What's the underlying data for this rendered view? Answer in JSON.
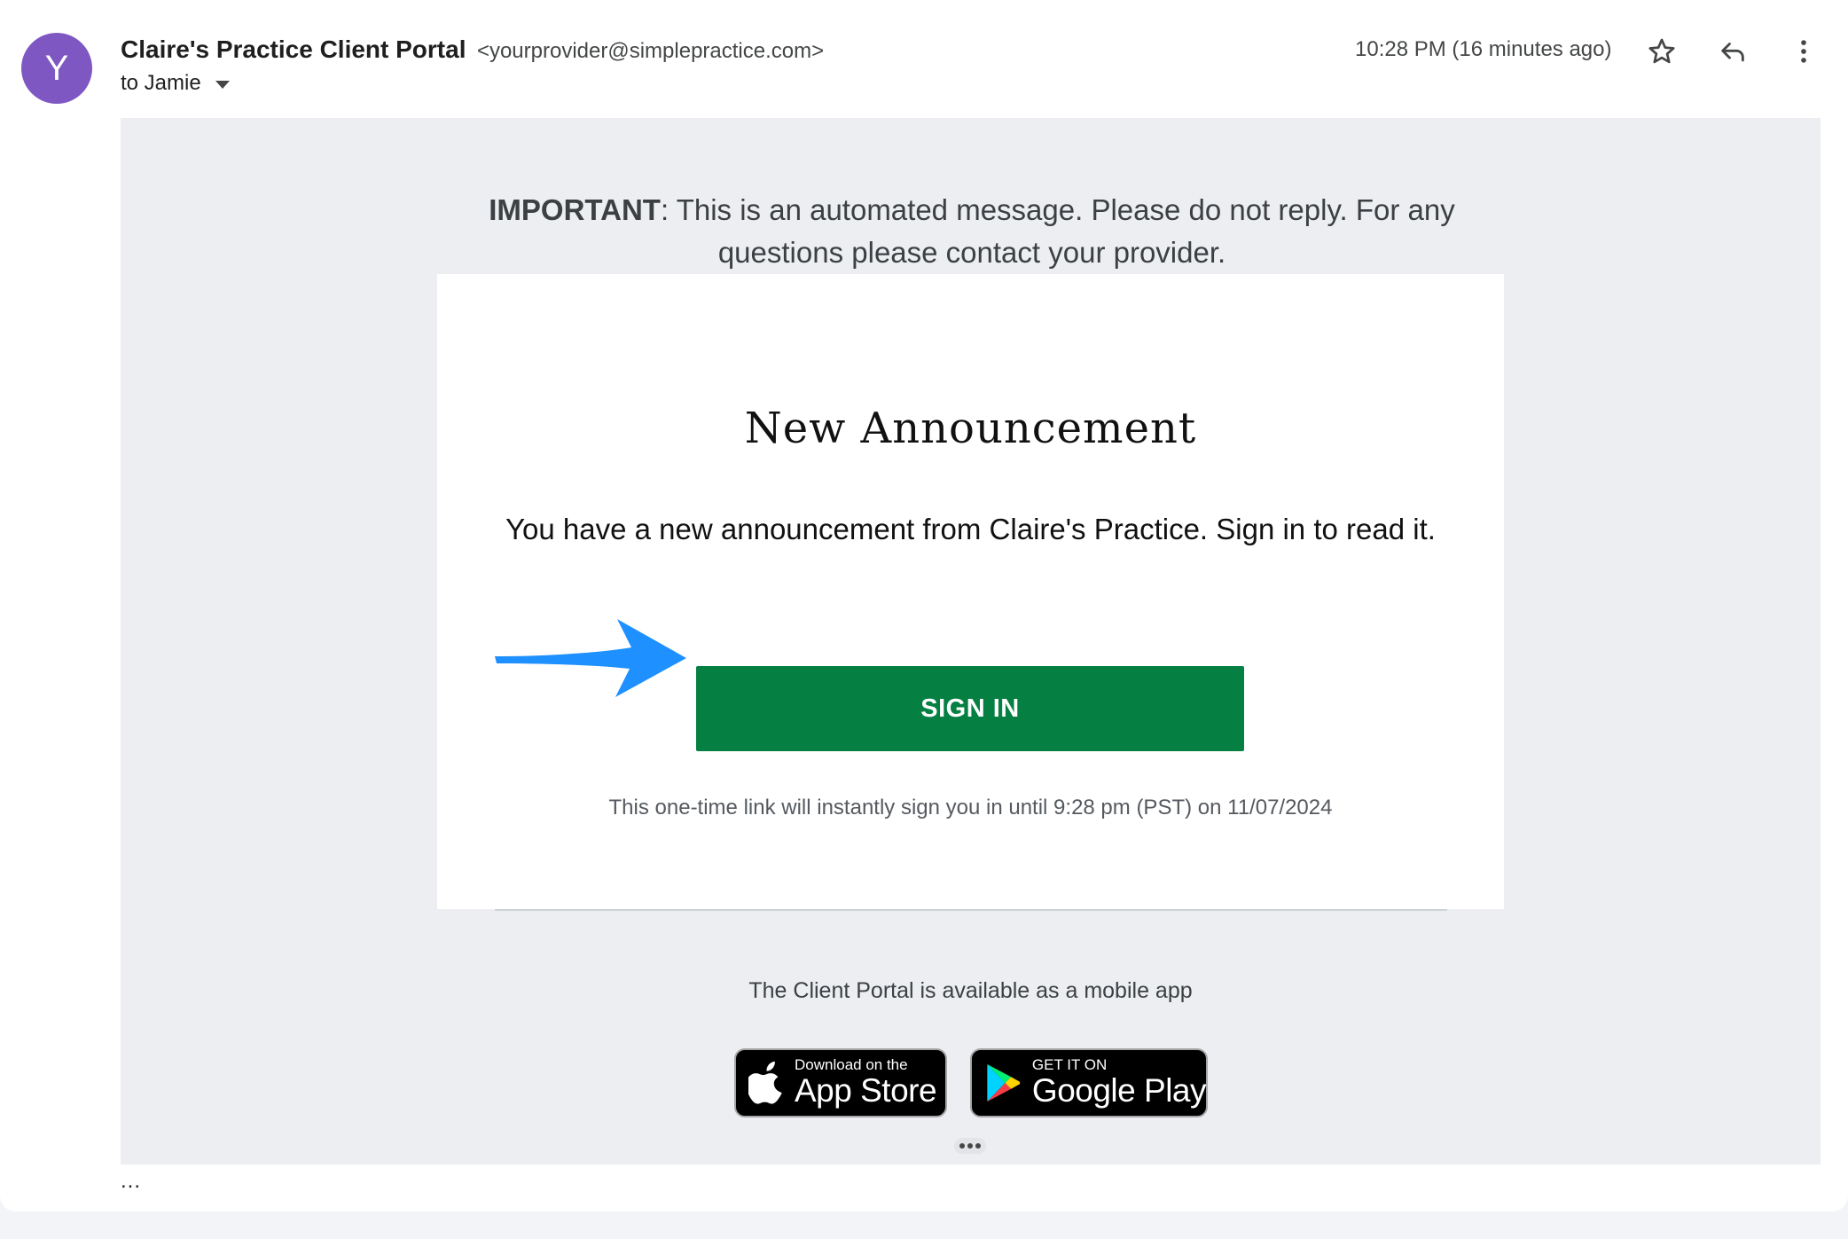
{
  "header": {
    "avatar_letter": "Y",
    "avatar_color": "#7e57c2",
    "sender_name": "Claire's Practice Client Portal",
    "sender_email": "<yourprovider@simplepractice.com>",
    "to_label": "to Jamie",
    "timestamp": "10:28 PM (16 minutes ago)",
    "icons": [
      "star-icon",
      "reply-icon",
      "more-vert-icon"
    ]
  },
  "email": {
    "important_bold": "IMPORTANT",
    "important_rest": ": This is an automated message. Please do not reply. For any questions please contact your provider.",
    "heading": "New Announcement",
    "announcement": "You have a new announcement from Claire's Practice. Sign in to read it.",
    "sign_in_label": "SIGN IN",
    "sign_in_color": "#057f42",
    "arrow_color": "#1e90ff",
    "one_time_note": "This one-time link will instantly sign you in until 9:28 pm (PST) on 11/07/2024",
    "mobile_note": "The Client Portal is available as a mobile app",
    "app_store": {
      "small": "Download on the",
      "big": "App Store"
    },
    "google_play": {
      "small": "GET IT ON",
      "big": "Google Play"
    }
  },
  "trailing_dots": "..."
}
